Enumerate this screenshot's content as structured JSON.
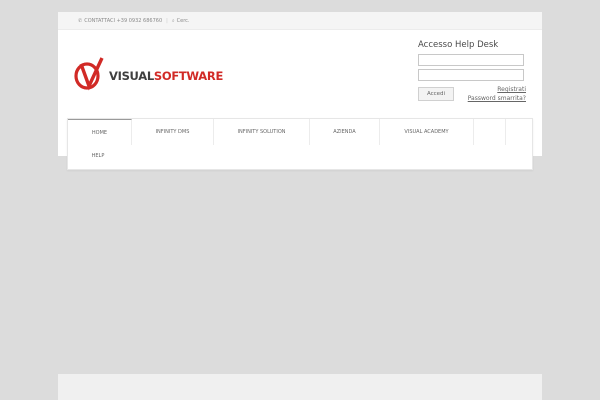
{
  "topbar": {
    "phone_icon": "phone-icon",
    "contact_text": "CONTATTACI +39 0932 686760",
    "separator": "|",
    "search_icon": "search-icon",
    "search_label": "Cerc."
  },
  "logo": {
    "text_part1": "VISUAL",
    "text_part2": "SOFTWARE",
    "brand_color": "#d12a26",
    "dark_color": "#3f3f3f"
  },
  "helpdesk": {
    "title": "Accesso Help Desk",
    "username_value": "",
    "password_value": "",
    "login_label": "Accedi",
    "register_link": "Registrati",
    "forgot_link": "Password smarrita?"
  },
  "nav": {
    "items": [
      {
        "label": "HOME"
      },
      {
        "label": "INFINITY DMS"
      },
      {
        "label": "INFINITY SOLUTION"
      },
      {
        "label": "AZIENDA"
      },
      {
        "label": "VISUAL ACADEMY"
      },
      {
        "label": ""
      },
      {
        "label": "HELP"
      }
    ]
  }
}
